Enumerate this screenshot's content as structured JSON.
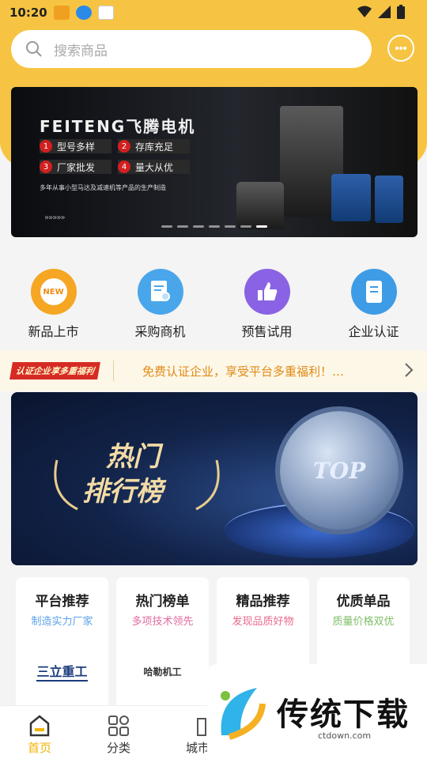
{
  "status_bar": {
    "time": "10:20"
  },
  "search": {
    "placeholder": "搜索商品"
  },
  "banner": {
    "brand": "FEITENG飞腾电机",
    "features": [
      {
        "num": "1",
        "text": "型号多样"
      },
      {
        "num": "2",
        "text": "存库充足"
      },
      {
        "num": "3",
        "text": "厂家批发"
      },
      {
        "num": "4",
        "text": "量大从优"
      }
    ],
    "subtitle": "多年从事小型马达及减速机等产品的生产制造",
    "arrows": "»»»»»"
  },
  "quick_menu": [
    {
      "label": "新品上市",
      "icon": "new-badge-icon",
      "color": "#f39a1d",
      "badge": "NEW"
    },
    {
      "label": "采购商机",
      "icon": "document-search-icon",
      "color": "#4aa6ea"
    },
    {
      "label": "预售试用",
      "icon": "thumbs-up-icon",
      "color": "#8a63e4"
    },
    {
      "label": "企业认证",
      "icon": "document-icon",
      "color": "#3e9ce6"
    }
  ],
  "notice": {
    "tag": "认证企业享多重福利",
    "text": "免费认证企业，享受平台多重福利！…"
  },
  "rank_banner": {
    "title_line1": "热门",
    "title_line2": "排行榜",
    "medal_text": "TOP"
  },
  "cards": [
    {
      "title": "平台推荐",
      "sub": "制造实力厂家",
      "sub_color": "#5aa2e8",
      "logo": "三立重工"
    },
    {
      "title": "热门榜单",
      "sub": "多项技术领先",
      "sub_color": "#e26aa0",
      "logo": "哈勒机工"
    },
    {
      "title": "精品推荐",
      "sub": "发现品质好物",
      "sub_color": "#e86a8c",
      "logo": ""
    },
    {
      "title": "优质单品",
      "sub": "质量价格双优",
      "sub_color": "#7fbf6a",
      "logo": ""
    }
  ],
  "bottom_nav": [
    {
      "label": "首页",
      "icon": "home-icon",
      "active": true
    },
    {
      "label": "分类",
      "icon": "grid-icon",
      "active": false
    },
    {
      "label": "城市",
      "icon": "city-icon",
      "active": false
    }
  ],
  "watermark": {
    "text": "传统下载",
    "url": "ctdown.com"
  },
  "colors": {
    "header": "#f6c442",
    "accent": "#f0b400",
    "notice_text": "#e08a15"
  }
}
